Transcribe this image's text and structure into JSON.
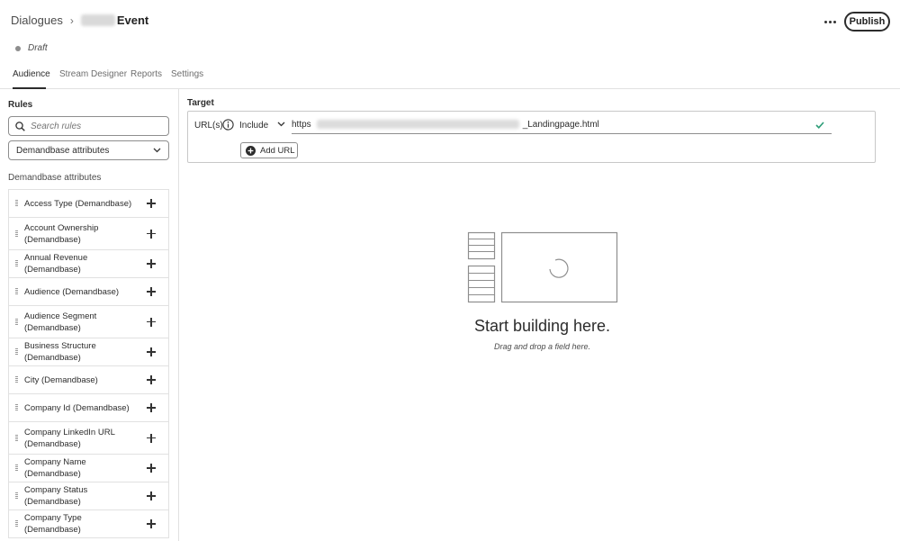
{
  "header": {
    "breadcrumb_root": "Dialogues",
    "breadcrumb_current": "Event",
    "publish_label": "Publish"
  },
  "status": {
    "text": "Draft"
  },
  "tabs": [
    {
      "label": "Audience",
      "active": true
    },
    {
      "label": "Stream Designer",
      "active": false
    },
    {
      "label": "Reports",
      "active": false
    },
    {
      "label": "Settings",
      "active": false
    }
  ],
  "rules": {
    "title": "Rules",
    "search_placeholder": "Search rules",
    "picker_value": "Demandbase attributes",
    "section_label": "Demandbase attributes",
    "items": [
      "Access Type (Demandbase)",
      "Account Ownership (Demandbase)",
      "Annual Revenue (Demandbase)",
      "Audience (Demandbase)",
      "Audience Segment (Demandbase)",
      "Business Structure (Demandbase)",
      "City (Demandbase)",
      "Company Id (Demandbase)",
      "Company LinkedIn URL (Demandbase)",
      "Company Name (Demandbase)",
      "Company Status (Demandbase)",
      "Company Type (Demandbase)"
    ]
  },
  "target": {
    "title": "Target",
    "url_label": "URL(s)",
    "match_mode": "Include",
    "url_prefix": "https",
    "url_suffix": "_Landingpage.html",
    "add_url_label": "Add URL"
  },
  "canvas": {
    "empty_title": "Start building here.",
    "empty_subtitle": "Drag and drop a field here."
  },
  "colors": {
    "text": "#2c2c2c",
    "border": "#e1e1e1",
    "success": "#2d9d78"
  }
}
